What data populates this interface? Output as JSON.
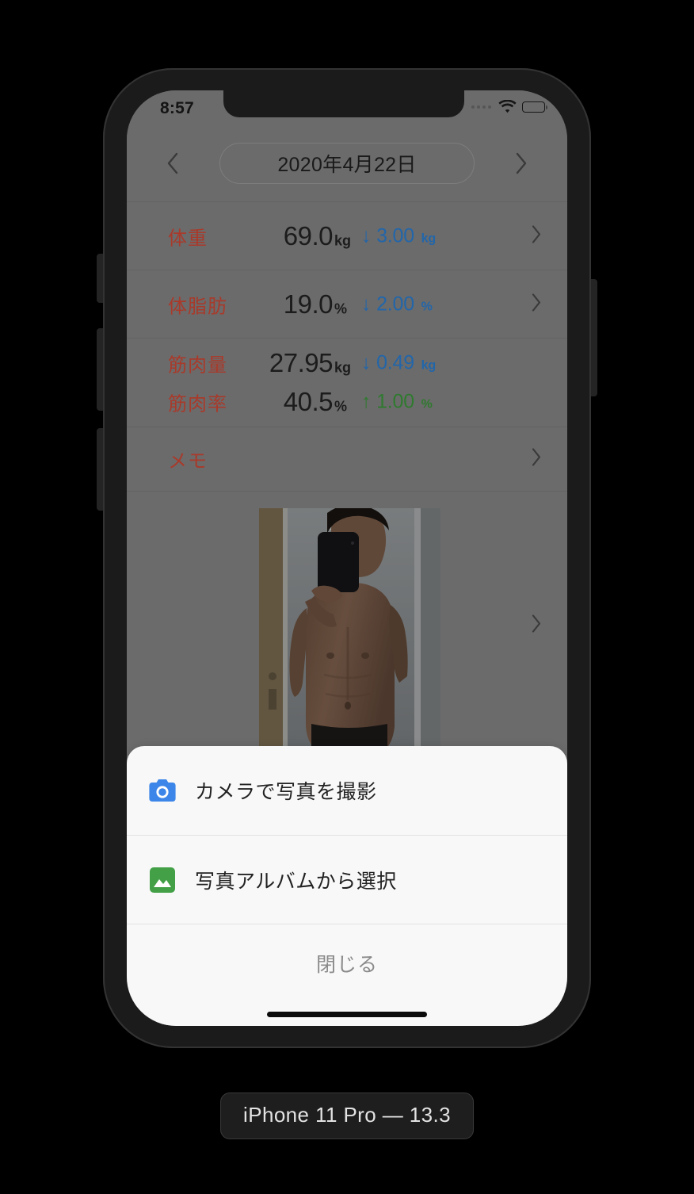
{
  "device": {
    "caption": "iPhone 11 Pro — 13.3"
  },
  "status_bar": {
    "time": "8:57",
    "signal_icon": "signal-dots-icon",
    "wifi_icon": "wifi-icon",
    "battery_icon": "battery-full-icon"
  },
  "date_header": {
    "prev_icon": "chevron-left-icon",
    "next_icon": "chevron-right-icon",
    "date": "2020年4月22日"
  },
  "metrics": [
    {
      "label": "体重",
      "value": "69.0",
      "unit": "kg",
      "delta_arrow": "↓",
      "delta_value": "3.00",
      "delta_unit": "kg",
      "direction": "down",
      "chevron_icon": "chevron-right-icon"
    },
    {
      "label": "体脂肪",
      "value": "19.0",
      "unit": "%",
      "delta_arrow": "↓",
      "delta_value": "2.00",
      "delta_unit": "%",
      "direction": "down",
      "chevron_icon": "chevron-right-icon"
    },
    {
      "label": "筋肉量",
      "value": "27.95",
      "unit": "kg",
      "delta_arrow": "↓",
      "delta_value": "0.49",
      "delta_unit": "kg",
      "direction": "down"
    },
    {
      "label": "筋肉率",
      "value": "40.5",
      "unit": "%",
      "delta_arrow": "↑",
      "delta_value": "1.00",
      "delta_unit": "%",
      "direction": "up"
    }
  ],
  "memo": {
    "label": "メモ",
    "chevron_icon": "chevron-right-icon"
  },
  "photo": {
    "thumbnail_name": "progress-photo-thumbnail",
    "chevron_icon": "chevron-right-icon"
  },
  "action_sheet": {
    "items": [
      {
        "label": "カメラで写真を撮影",
        "icon": "camera-icon",
        "icon_color": "#3b86e8"
      },
      {
        "label": "写真アルバムから選択",
        "icon": "photo-album-icon",
        "icon_color": "#43a047"
      }
    ],
    "close_label": "閉じる"
  },
  "colors": {
    "label_red": "#a83a2b",
    "delta_down_blue": "#2266aa",
    "delta_up_green": "#2f7a2f",
    "sheet_background": "#f8f8f8",
    "dimmed_background": "#6b6b6b"
  }
}
